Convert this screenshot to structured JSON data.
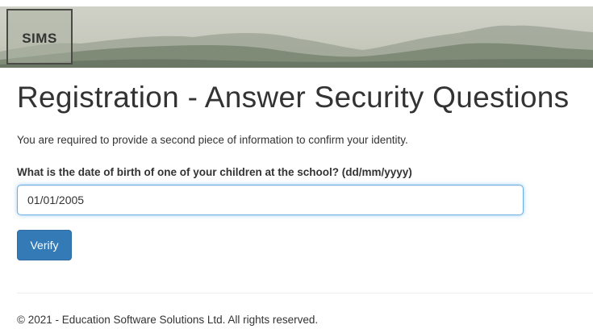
{
  "header": {
    "logo_text": "SIMS"
  },
  "page": {
    "title": "Registration - Answer Security Questions",
    "intro": "You are required to provide a second piece of information to confirm your identity."
  },
  "form": {
    "question_label": "What is the date of birth of one of your children at the school? (dd/mm/yyyy)",
    "dob_value": "01/01/2005",
    "verify_label": "Verify"
  },
  "footer": {
    "copyright": "© 2021 - Education Software Solutions Ltd. All rights reserved."
  },
  "colors": {
    "primary_button": "#337ab7",
    "input_focus": "#66afe9",
    "banner_sky": "#cccec3",
    "mountain_dark": "#6b7866"
  },
  "icons": {
    "banner": "mountain-landscape"
  }
}
